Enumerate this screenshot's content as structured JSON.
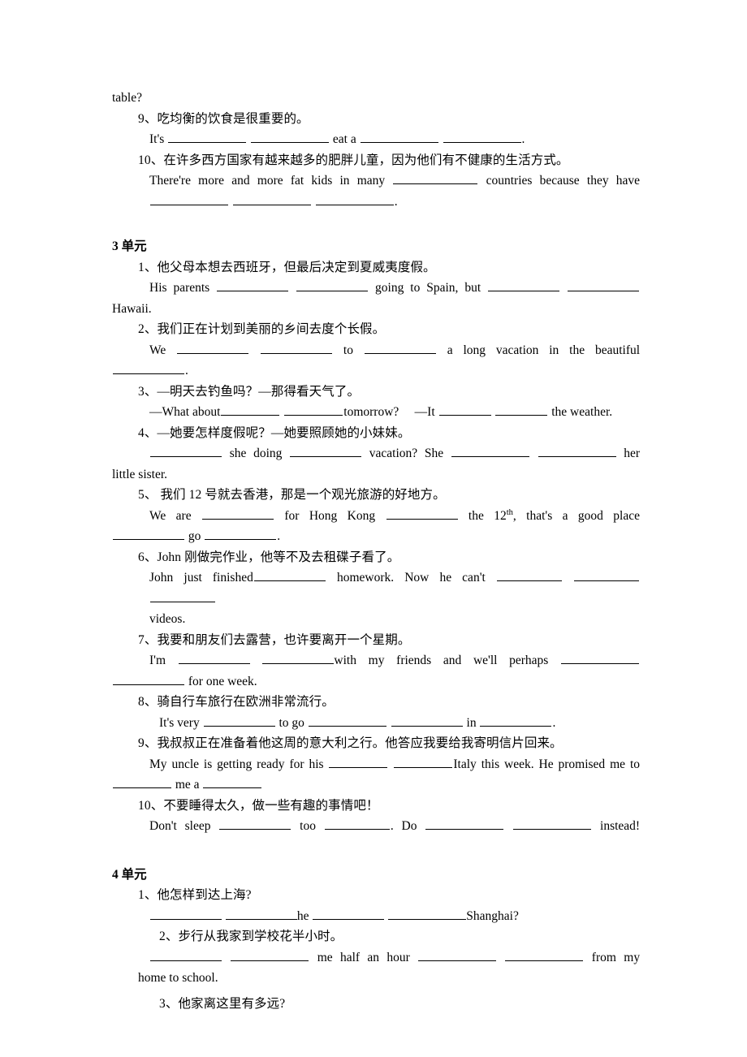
{
  "document": {
    "type": "english-translation-worksheet",
    "language_mix": [
      "Chinese",
      "English"
    ],
    "carryover_text": "table?"
  },
  "carryover": {
    "text": "table?"
  },
  "unit2_tail": {
    "items": [
      {
        "number": "9、",
        "chinese": "吃均衡的饮食是很重要的。",
        "english_parts": [
          "It's",
          "eat a",
          "."
        ]
      },
      {
        "number": "10、",
        "chinese": "在许多西方国家有越来越多的肥胖儿童，因为他们有不健康的生活方式。",
        "english_parts": [
          "There're more and more fat kids in many",
          "countries because they have",
          "."
        ]
      }
    ]
  },
  "unit3": {
    "heading": "3 单元",
    "items": [
      {
        "number": "1、",
        "chinese": "他父母本想去西班牙，但最后决定到夏威夷度假。",
        "english_lead": "His parents",
        "english_mid": "going to Spain, but",
        "english_tail": "Hawaii."
      },
      {
        "number": "2、",
        "chinese": "我们正在计划到美丽的乡间去度个长假。",
        "english_lead": "We",
        "english_mid": "to",
        "english_mid2": "a long vacation in the beautiful",
        "english_tail": "."
      },
      {
        "number": "3、",
        "chinese": "—明天去钓鱼吗？—那得看天气了。",
        "english_q_lead": "—What about",
        "english_q_tail": "tomorrow?",
        "english_a_lead": "—It",
        "english_a_tail": "the weather."
      },
      {
        "number": "4、",
        "chinese": "—她要怎样度假呢？—她要照顾她的小妹妹。",
        "english_mid1": "she doing",
        "english_mid2": "vacation?",
        "english_mid3": "She",
        "english_tail_inline": "her",
        "english_tail": "little sister."
      },
      {
        "number": "5、",
        "chinese": "我们 12 号就去香港，那是一个观光旅游的好地方。",
        "english_lead": "We are",
        "english_mid": "for Hong Kong",
        "english_date_pre": "the 12",
        "english_date_sup": "th",
        "english_date_post": ", that's a good place",
        "english_tail_go": "go",
        "english_tail_end": "."
      },
      {
        "number": "6、",
        "chinese": "John 刚做完作业，他等不及去租碟子看了。",
        "english_lead": "John just finished",
        "english_mid": "homework. Now he can't",
        "english_tail": "videos."
      },
      {
        "number": "7、",
        "chinese": "我要和朋友们去露营，也许要离开一个星期。",
        "english_lead": "I'm",
        "english_mid": "with my friends and we'll perhaps",
        "english_tail": "for one week."
      },
      {
        "number": "8、",
        "chinese": "骑自行车旅行在欧洲非常流行。",
        "english_lead": "It's very",
        "english_mid": "to go",
        "english_mid2": "in",
        "english_tail": "."
      },
      {
        "number": "9、",
        "chinese": "我叔叔正在准备着他这周的意大利之行。他答应我要给我寄明信片回来。",
        "english_lead": "My uncle is getting ready for his",
        "english_mid": "Italy this week. He promised me to",
        "english_tail": "me a"
      },
      {
        "number": "10、",
        "chinese": "不要睡得太久，做一些有趣的事情吧！",
        "english_lead": "Don't sleep",
        "english_mid": "too",
        "english_mid2": ". Do",
        "english_tail": "instead!"
      }
    ]
  },
  "unit4": {
    "heading": "4 单元",
    "items": [
      {
        "number": "1、",
        "chinese": "他怎样到达上海?",
        "english_mid": "he",
        "english_tail": "Shanghai?"
      },
      {
        "number": "2、",
        "chinese": "步行从我家到学校花半小时。",
        "english_mid": "me half an hour",
        "english_tail_inline": "from my",
        "english_tail": "home to school."
      },
      {
        "number": "3、",
        "chinese": "他家离这里有多远?"
      }
    ]
  }
}
